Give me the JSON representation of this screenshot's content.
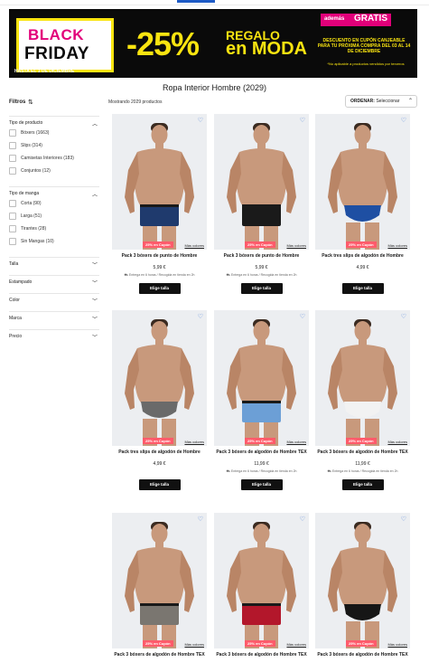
{
  "banner": {
    "bf_black": "BLACK",
    "bf_friday": "FRIDAY",
    "bf_date": "HASTA EL 1 DE DICIEMBRE",
    "discount": "-25%",
    "regalo": "REGALO",
    "moda": "en MODA",
    "badge": "además",
    "badge_gratis": "GRATIS",
    "desc": "DESCUENTO EN CUPÓN CANJEABLE PARA TU PRÓXIMA COMPRA DEL 03 AL 14 DE DICIEMBRE",
    "note": "*No aplicable a productos vendidos por terceros"
  },
  "page_title": "Ropa Interior Hombre (2029)",
  "filters_title": "Filtros",
  "showing": "Mostrando 2029 productos",
  "sort": {
    "label": "ORDENAR:",
    "value": "Seleccionar"
  },
  "facets": [
    {
      "label": "Tipo de producto",
      "open": true,
      "options": [
        "Bóxers (1663)",
        "Slips (314)",
        "Camisetas Interiores (183)",
        "Conjuntos (12)"
      ]
    },
    {
      "label": "Tipo de manga",
      "open": true,
      "options": [
        "Corta (90)",
        "Larga (51)",
        "Tirantes (28)",
        "Sin Mangas (10)"
      ]
    },
    {
      "label": "Talla",
      "open": false,
      "options": []
    },
    {
      "label": "Estampado",
      "open": false,
      "options": []
    },
    {
      "label": "Color",
      "open": false,
      "options": []
    },
    {
      "label": "Marca",
      "open": false,
      "options": []
    },
    {
      "label": "Precio",
      "open": false,
      "options": []
    }
  ],
  "product_common": {
    "tag": "25% en Cupón",
    "more_colors": "Más colores",
    "button": "Elige talla"
  },
  "products": [
    {
      "title": "Pack 3 bóxers de punto de Hombre",
      "price": "5,99 €",
      "delivery": "Entrega en 6 horas / Recogida en tienda en 2h",
      "brief": "#1f3a6d"
    },
    {
      "title": "Pack 3 bóxers de punto de Hombre",
      "price": "5,99 €",
      "delivery": "Entrega en 6 horas / Recogida en tienda en 2h",
      "brief": "#1a1a1a"
    },
    {
      "title": "Pack tres slips de algodón de Hombre",
      "price": "4,99 €",
      "delivery": "",
      "brief": "#1e4fa3"
    },
    {
      "title": "Pack tres slips de algodón de Hombre",
      "price": "4,99 €",
      "delivery": "",
      "brief": "#6a6a6a"
    },
    {
      "title": "Pack 3 bóxers de algodón de Hombre TEX",
      "price": "11,99 €",
      "delivery": "Entrega en 6 horas / Recogida en tienda en 2h",
      "brief": "#6c9fd6"
    },
    {
      "title": "Pack 3 bóxers de algodón de Hombre TEX",
      "price": "11,99 €",
      "delivery": "Entrega en 6 horas / Recogida en tienda en 2h",
      "brief": "#f2f2f2"
    },
    {
      "title": "Pack 3 bóxers de algodón de Hombre TEX",
      "price": "",
      "delivery": "",
      "brief": "#7a7670"
    },
    {
      "title": "Pack 3 bóxers de algodón de Hombre TEX",
      "price": "",
      "delivery": "",
      "brief": "#b3172b"
    },
    {
      "title": "Pack 3 bóxers de algodón de Hombre TEX",
      "price": "",
      "delivery": "",
      "brief": "#161616"
    }
  ]
}
